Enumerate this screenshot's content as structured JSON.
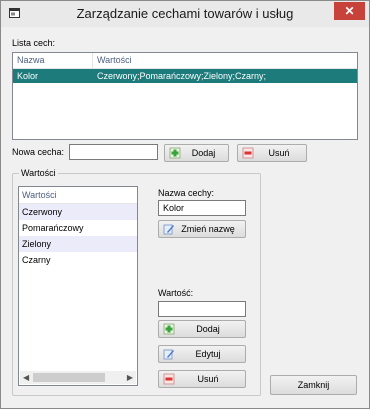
{
  "window": {
    "title": "Zarządzanie cechami towarów i usług",
    "close_label": "✕"
  },
  "features": {
    "label": "Lista cech:",
    "columns": [
      "Nazwa",
      "Wartości"
    ],
    "rows": [
      {
        "name": "Kolor",
        "values": "Czerwony;Pomarańczowy;Zielony;Czarny;"
      }
    ]
  },
  "new_feature": {
    "label": "Nowa cecha:",
    "value": "",
    "add_label": "Dodaj",
    "remove_label": "Usuń"
  },
  "values_group": {
    "title": "Wartości",
    "list_header": "Wartości",
    "items": [
      "Czerwony",
      "Pomarańczowy",
      "Zielony",
      "Czarny"
    ],
    "feature_name_label": "Nazwa cechy:",
    "feature_name_value": "Kolor",
    "rename_label": "Zmień nazwę",
    "value_label": "Wartość:",
    "value_input": "",
    "add_label": "Dodaj",
    "edit_label": "Edytuj",
    "remove_label": "Usuń"
  },
  "close_button_label": "Zamknij",
  "colors": {
    "selection": "#1e7b7b",
    "close_button": "#c7423b"
  },
  "icons": [
    "app-window-icon",
    "add-icon",
    "remove-icon",
    "rename-icon",
    "edit-icon"
  ]
}
